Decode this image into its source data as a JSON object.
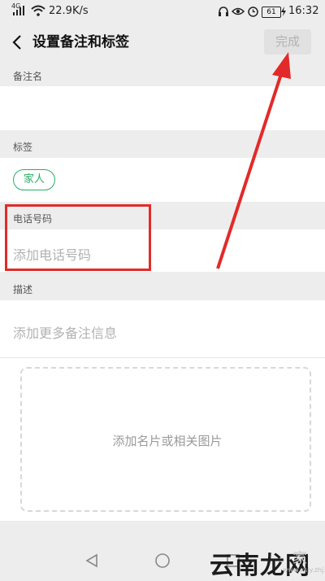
{
  "status_bar": {
    "network_type": "4G",
    "speed": "22.9K/s",
    "battery": "61",
    "time": "16:32"
  },
  "header": {
    "title": "设置备注和标签",
    "done_label": "完成"
  },
  "remark": {
    "label": "备注名"
  },
  "tags": {
    "label": "标签",
    "items": [
      "家人"
    ]
  },
  "phone": {
    "label": "电话号码",
    "placeholder": "添加电话号码"
  },
  "description": {
    "label": "描述",
    "placeholder": "添加更多备注信息"
  },
  "photo": {
    "placeholder": "添加名片或相关图片"
  },
  "watermark": {
    "brand": "云南龙网",
    "faint": "家",
    "url": "www.xsjy.zhj.com"
  },
  "colors": {
    "accent_green": "#2aae67",
    "annotation_red": "#e32a2a",
    "background": "#ededed"
  }
}
